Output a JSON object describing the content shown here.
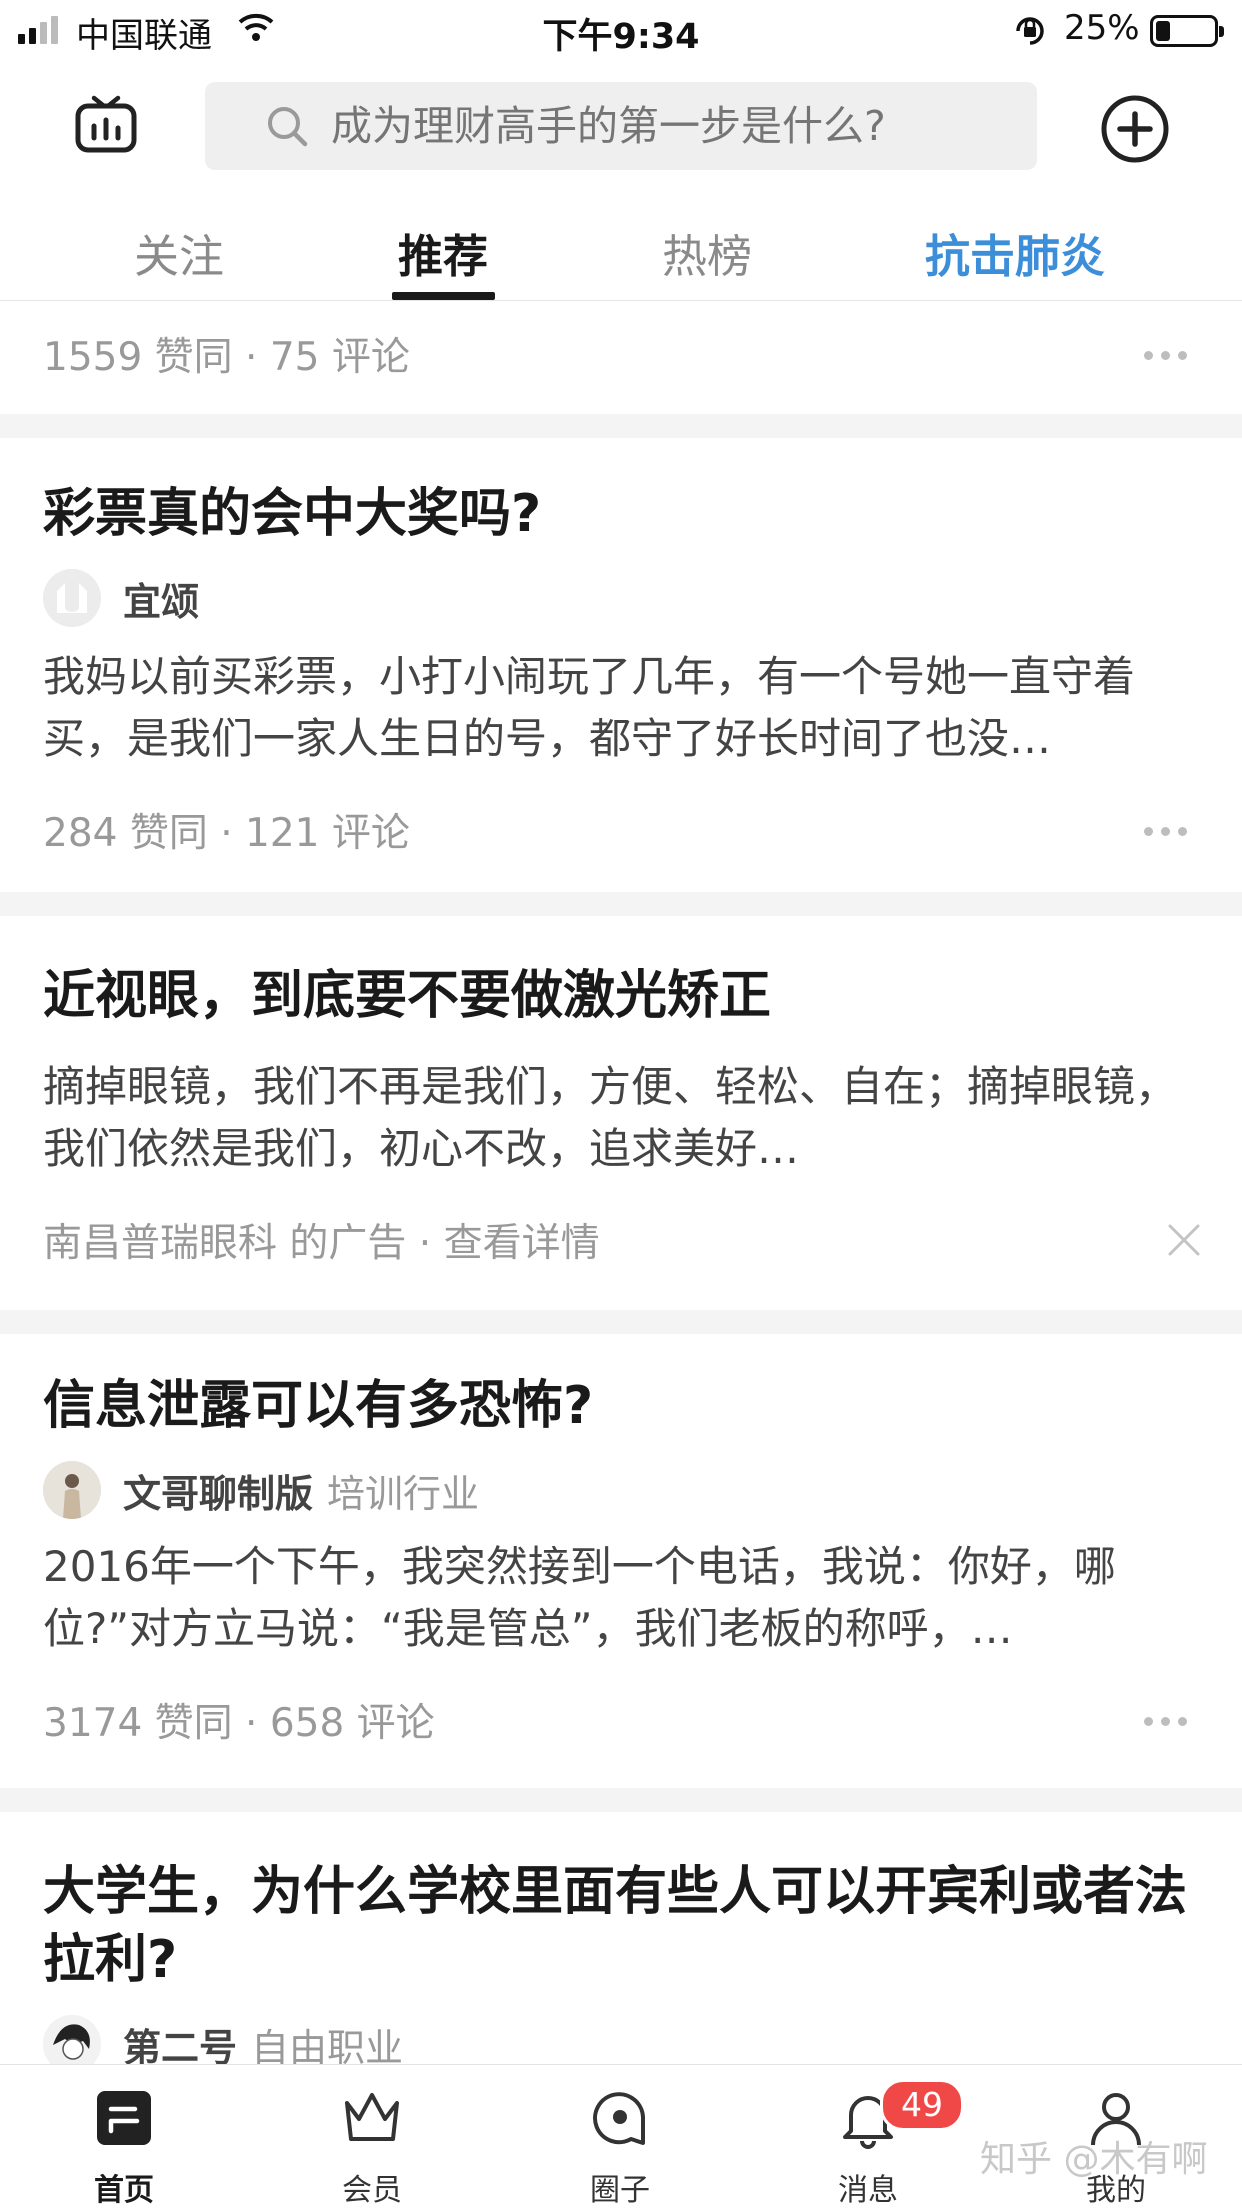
{
  "status_bar": {
    "carrier": "中国联通",
    "time": "下午9:34",
    "battery_percent": "25%",
    "battery_level": 0.25,
    "icons": [
      "signal-icon",
      "wifi-icon",
      "orientation-lock-icon",
      "battery-icon"
    ]
  },
  "header": {
    "search_placeholder": "成为理财高手的第一步是什么?",
    "icons": [
      "tv-icon",
      "search-icon",
      "add-icon"
    ]
  },
  "tabs": [
    {
      "label": "关注"
    },
    {
      "label": "推荐"
    },
    {
      "label": "热榜"
    },
    {
      "label": "抗击肺炎"
    }
  ],
  "colors": {
    "accent_tab": "#3d8ed8",
    "badge": "#f04846"
  },
  "feed": {
    "partial_card": {
      "stats": "1559 赞同 · 75 评论"
    },
    "cards": [
      {
        "title": "彩票真的会中大奖吗?",
        "author": "宜颂",
        "author_tag": "",
        "excerpt": "我妈以前买彩票，小打小闹玩了几年，有一个号她一直守着买，是我们一家人生日的号，都守了好长时间了也没…",
        "stats": "284 赞同 · 121 评论"
      },
      {
        "title": "近视眼，到底要不要做激光矫正",
        "excerpt": "摘掉眼镜，我们不再是我们，方便、轻松、自在；摘掉眼镜，我们依然是我们，初心不改，追求美好…",
        "ad_meta": "南昌普瑞眼科 的广告 · 查看详情"
      },
      {
        "title": "信息泄露可以有多恐怖?",
        "author": "文哥聊制版",
        "author_tag": "培训行业",
        "excerpt": "2016年一个下午，我突然接到一个电话，我说：你好，哪位?”对方立马说：“我是管总”，我们老板的称呼，…",
        "stats": "3174 赞同 · 658 评论"
      },
      {
        "title": "大学生，为什么学校里面有些人可以开宾利或者法拉利?",
        "author": "第二号",
        "author_tag": "自由职业"
      }
    ]
  },
  "bottom_nav": [
    {
      "label": "首页",
      "icon": "home-icon"
    },
    {
      "label": "会员",
      "icon": "crown-icon"
    },
    {
      "label": "圈子",
      "icon": "circle-icon"
    },
    {
      "label": "消息",
      "icon": "bell-icon",
      "badge": "49"
    },
    {
      "label": "我的",
      "icon": "profile-icon"
    }
  ],
  "watermark": "知乎 @木有啊"
}
